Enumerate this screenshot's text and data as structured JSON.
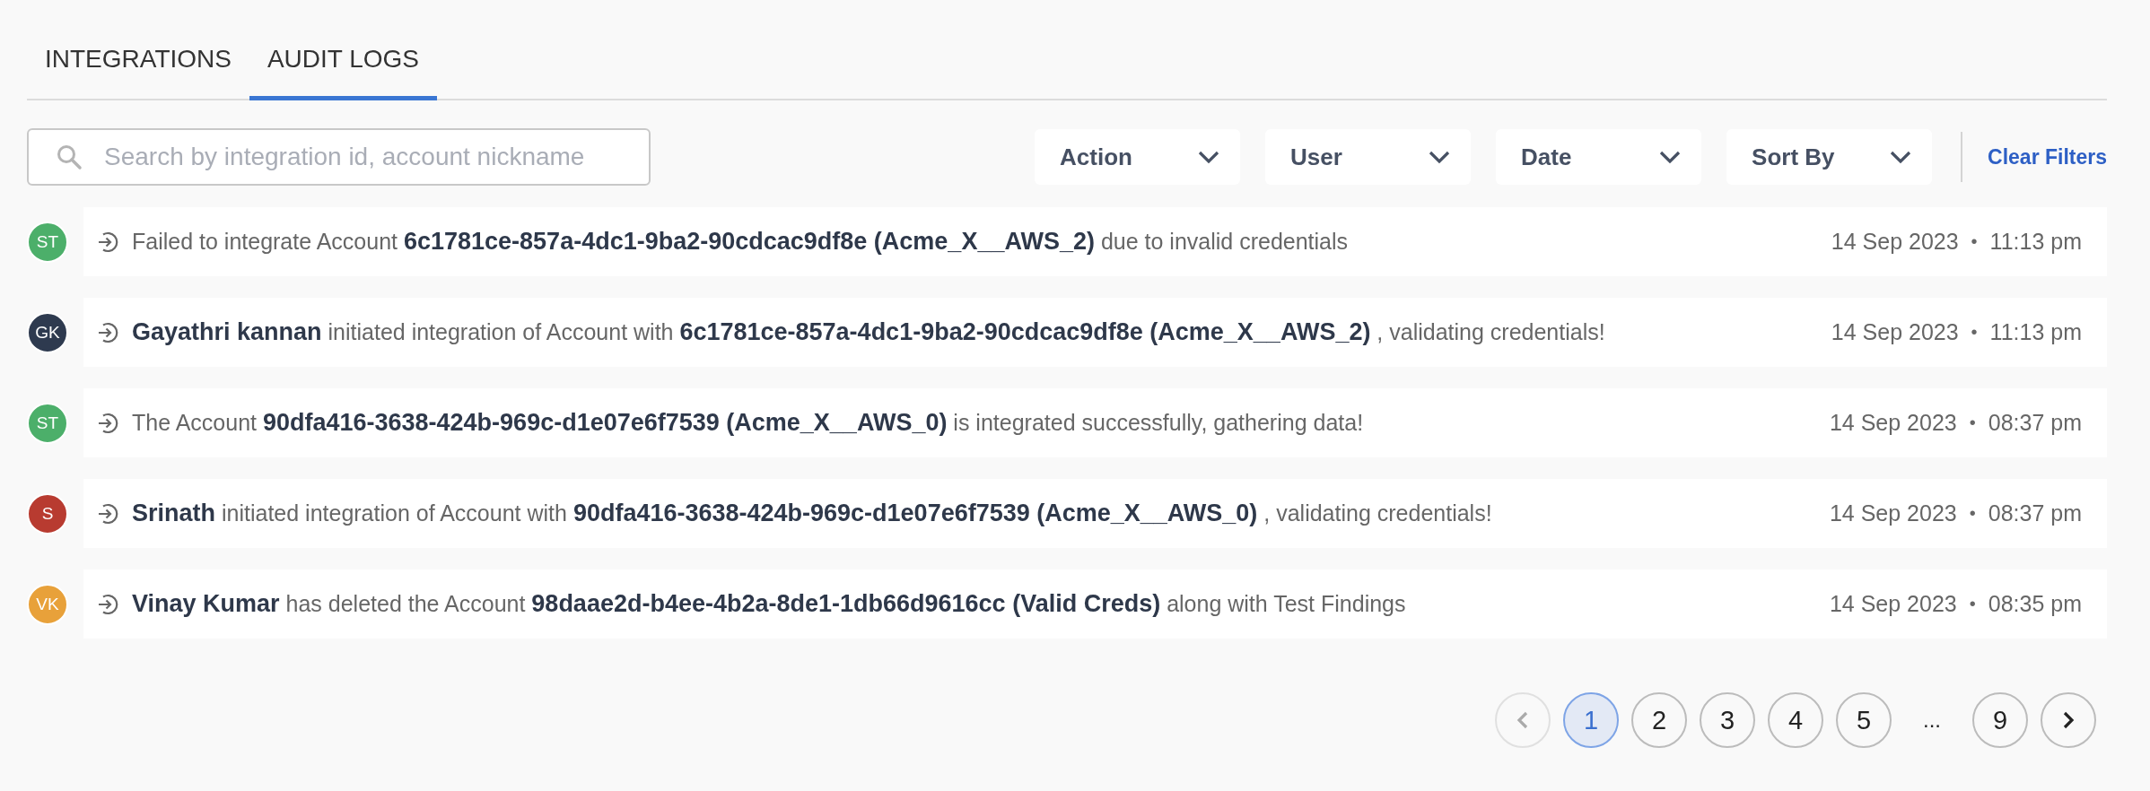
{
  "tabs": [
    {
      "label": "INTEGRATIONS",
      "selected": false
    },
    {
      "label": "AUDIT LOGS",
      "selected": true
    }
  ],
  "search": {
    "placeholder": "Search by integration id, account nickname"
  },
  "filters": [
    {
      "label": "Action"
    },
    {
      "label": "User"
    },
    {
      "label": "Date"
    },
    {
      "label": "Sort By"
    }
  ],
  "clear_filters": "Clear Filters",
  "logs": [
    {
      "initials": "ST",
      "color": "#4caf6a",
      "message": "Failed to integrate Account **6c1781ce-857a-4dc1-9ba2-90cdcac9df8e (Acme_X__AWS_2)** due to invalid credentials",
      "date": "14 Sep 2023",
      "separator": "•",
      "time": "11:13 pm"
    },
    {
      "initials": "GK",
      "color": "#2e3a4f",
      "message": "**Gayathri kannan** initiated integration of Account with **6c1781ce-857a-4dc1-9ba2-90cdcac9df8e (Acme_X__AWS_2)** , validating credentials!",
      "date": "14 Sep 2023",
      "separator": "•",
      "time": "11:13 pm"
    },
    {
      "initials": "ST",
      "color": "#4caf6a",
      "message": "The Account **90dfa416-3638-424b-969c-d1e07e6f7539 (Acme_X__AWS_0)** is integrated successfully, gathering data!",
      "date": "14 Sep 2023",
      "separator": "•",
      "time": "08:37 pm"
    },
    {
      "initials": "S",
      "color": "#b83b30",
      "message": "**Srinath** initiated integration of Account with **90dfa416-3638-424b-969c-d1e07e6f7539 (Acme_X__AWS_0)** , validating credentials!",
      "date": "14 Sep 2023",
      "separator": "•",
      "time": "08:37 pm"
    },
    {
      "initials": "VK",
      "color": "#e8a13a",
      "message": "**Vinay Kumar** has deleted the Account **98daae2d-b4ee-4b2a-8de1-1db66d9616cc (Valid Creds)** along with Test Findings",
      "date": "14 Sep 2023",
      "separator": "•",
      "time": "08:35 pm"
    }
  ],
  "pagination": {
    "previous_disabled": true,
    "pages": [
      {
        "kind": "page",
        "label": "1",
        "selected": true
      },
      {
        "kind": "page",
        "label": "2",
        "selected": false
      },
      {
        "kind": "page",
        "label": "3",
        "selected": false
      },
      {
        "kind": "page",
        "label": "4",
        "selected": false
      },
      {
        "kind": "page",
        "label": "5",
        "selected": false
      },
      {
        "kind": "ellipsis",
        "label": "..."
      },
      {
        "kind": "page",
        "label": "9",
        "selected": false
      }
    ],
    "next_disabled": false
  }
}
